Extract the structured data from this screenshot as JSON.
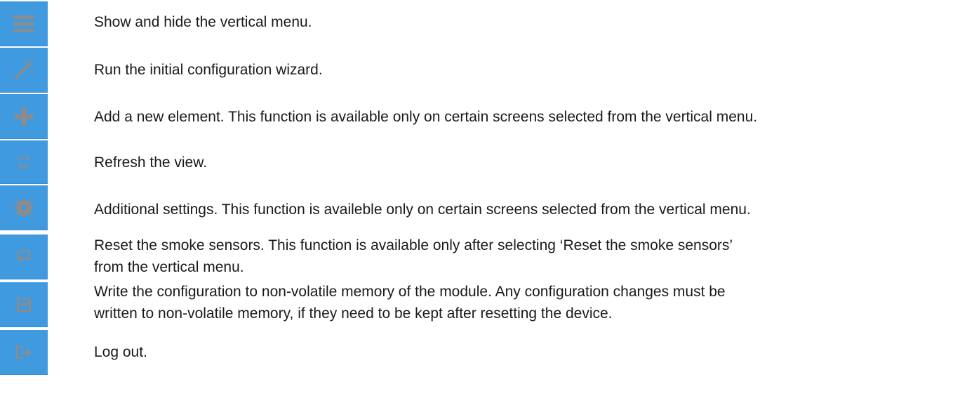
{
  "colors": {
    "icon_background": "#3f9ae0",
    "icon_glyph": "#8c8c8c",
    "text": "#1a1a1a"
  },
  "items": [
    {
      "icon": "hamburger-menu-icon",
      "lines": [
        "Show and hide the vertical menu."
      ]
    },
    {
      "icon": "magic-wand-icon",
      "lines": [
        "Run the initial configuration wizard."
      ]
    },
    {
      "icon": "plus-icon",
      "lines": [
        "Add a new element. This function is available only on certain screens selected from the vertical menu."
      ]
    },
    {
      "icon": "refresh-icon",
      "lines": [
        "Refresh the view."
      ]
    },
    {
      "icon": "gear-icon",
      "lines": [
        "Additional settings. This function is availeble only on certain screens selected from the vertical menu."
      ]
    },
    {
      "icon": "reset-icon",
      "lines": [
        "Reset the smoke sensors. This function is available only after selecting ‘Reset the smoke sensors’",
        "from the vertical menu."
      ]
    },
    {
      "icon": "floppy-disk-icon",
      "lines": [
        "Write the configuration to non-volatile memory of the module. Any configuration changes must be",
        "written to non-volatile memory, if they need to be kept after resetting the device."
      ]
    },
    {
      "icon": "logout-icon",
      "lines": [
        "Log out."
      ]
    }
  ]
}
